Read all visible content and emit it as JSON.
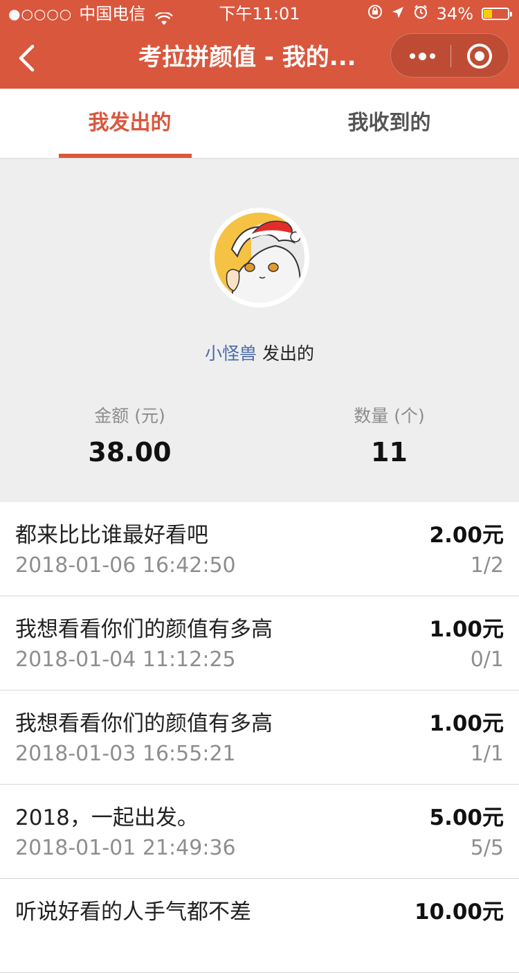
{
  "status_bar": {
    "signal": "●○○○○",
    "carrier": "中国电信",
    "time": "下午11:01",
    "battery_percent": "34%",
    "battery_level": 0.34
  },
  "nav": {
    "title": "考拉拼颜值 - 我的...",
    "back_icon": "chevron-left-icon",
    "more_icon": "more-dots-icon",
    "close_icon": "target-close-icon"
  },
  "tabs": [
    {
      "label": "我发出的",
      "active": true
    },
    {
      "label": "我收到的",
      "active": false
    }
  ],
  "summary": {
    "owner_name": "小怪兽",
    "owner_suffix": "发出的",
    "amount_label": "金额 (元)",
    "amount_value": "38.00",
    "count_label": "数量 (个)",
    "count_value": "11"
  },
  "records": [
    {
      "title": "都来比比谁最好看吧",
      "time": "2018-01-06 16:42:50",
      "amount": "2.00元",
      "count": "1/2"
    },
    {
      "title": "我想看看你们的颜值有多高",
      "time": "2018-01-04 11:12:25",
      "amount": "1.00元",
      "count": "0/1"
    },
    {
      "title": "我想看看你们的颜值有多高",
      "time": "2018-01-03 16:55:21",
      "amount": "1.00元",
      "count": "1/1"
    },
    {
      "title": "2018，一起出发。",
      "time": "2018-01-01 21:49:36",
      "amount": "5.00元",
      "count": "5/5"
    },
    {
      "title": "听说好看的人手气都不差",
      "time": "",
      "amount": "10.00元",
      "count": ""
    }
  ],
  "colors": {
    "brand": "#d9573d",
    "link": "#4a6aa8",
    "summary_bg": "#eeeeef"
  }
}
